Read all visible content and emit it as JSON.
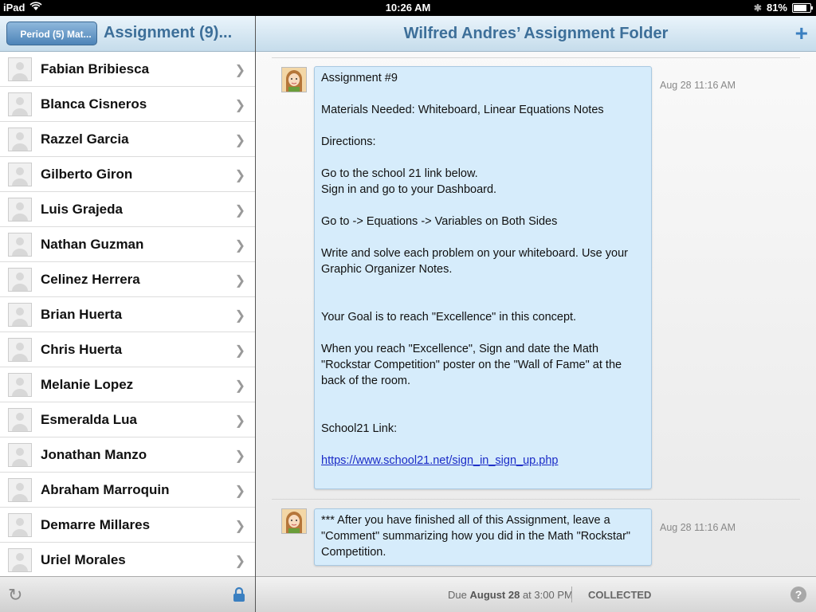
{
  "status_bar": {
    "device": "iPad",
    "time": "10:26 AM",
    "battery": "81%"
  },
  "left": {
    "back_label": "Period (5) Mat...",
    "title": "Assignment (9)...",
    "students": [
      "Fabian Bribiesca",
      "Blanca Cisneros",
      "Razzel Garcia",
      "Gilberto Giron",
      "Luis Grajeda",
      "Nathan Guzman",
      "Celinez Herrera",
      "Brian Huerta",
      "Chris Huerta",
      "Melanie Lopez",
      "Esmeralda Lua",
      "Jonathan Manzo",
      "Abraham Marroquin",
      "Demarre Millares",
      "Uriel Morales"
    ]
  },
  "right": {
    "title": "Wilfred Andres’ Assignment Folder",
    "messages": [
      {
        "lines": [
          "Assignment #9",
          "",
          "Materials Needed: Whiteboard,  Linear Equations Notes",
          "",
          "Directions:",
          "",
          "Go to the school 21 link below.",
          "Sign in and go to your Dashboard.",
          "",
          "Go to ->  Equations -> Variables on Both Sides",
          "",
          "Write and solve each problem on your whiteboard. Use your Graphic Organizer Notes.",
          "",
          "",
          "Your Goal is to reach \"Excellence\" in this concept.",
          "",
          "When you reach \"Excellence\", Sign and date the Math \"Rockstar Competition\" poster on the \"Wall of Fame\" at the back of the room.",
          "",
          "",
          "School21 Link:",
          ""
        ],
        "link": "https://www.school21.net/sign_in_sign_up.php",
        "timestamp": "Aug 28 11:16 AM"
      },
      {
        "lines": [
          "*** After you have finished all of this Assignment, leave a \"Comment\" summarizing how you did in the Math \"Rockstar\" Competition."
        ],
        "timestamp": "Aug 28 11:16 AM"
      }
    ],
    "footer": {
      "due_prefix": "Due",
      "due_date": "August 28",
      "due_suffix": "at 3:00 PM",
      "status": "COLLECTED",
      "help": "?"
    }
  }
}
